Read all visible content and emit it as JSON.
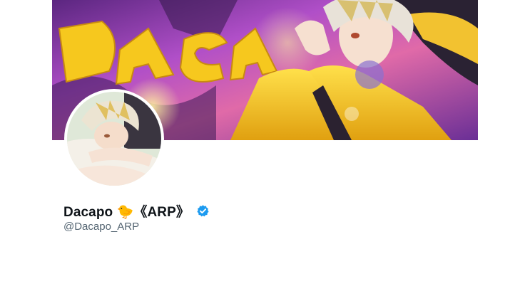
{
  "profile": {
    "display_name": "Dacapo 🐤《ARP》",
    "handle": "@Dacapo_ARP",
    "verified": true
  },
  "banner": {
    "graffiti_text": "DACAPO"
  },
  "icons": {
    "verified": "verified-badge-icon"
  },
  "colors": {
    "verified_blue": "#1d9bf0",
    "name_text": "#0f1419",
    "handle_text": "#536471",
    "banner_purple": "#8a3cb0",
    "banner_yellow": "#f2c230"
  }
}
